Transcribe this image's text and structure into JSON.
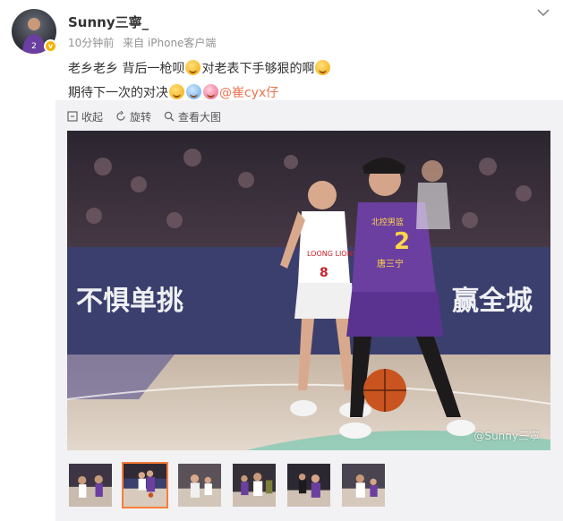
{
  "post": {
    "author": "Sunny三寧_",
    "time": "10分钟前",
    "source": "来自 iPhone客户端",
    "line1_part1": "老乡老乡 背后一枪呗",
    "line1_part2": "对老表下手够狠的啊",
    "line2_part1": "期待下一次的对决",
    "mention": "@崔cyx仔"
  },
  "toolbar": {
    "collect": "收起",
    "rotate": "旋转",
    "view_large": "查看大图"
  },
  "photo": {
    "banner_left": "不惧单挑",
    "banner_right": "赢全城",
    "jersey_white_number": "8",
    "jersey_white_team": "LOONG LIONS",
    "jersey_purple_number": "2",
    "jersey_purple_team": "北控男篮",
    "jersey_purple_name": "唐三宁",
    "watermark": "@Sunny三寧"
  },
  "thumbnails": [
    {
      "id": "thumb-1",
      "active": false
    },
    {
      "id": "thumb-2",
      "active": true
    },
    {
      "id": "thumb-3",
      "active": false
    },
    {
      "id": "thumb-4",
      "active": false
    },
    {
      "id": "thumb-5",
      "active": false
    },
    {
      "id": "thumb-6",
      "active": false
    }
  ],
  "colors": {
    "mention": "#eb7350",
    "thumb_active_border": "#fa7d3c",
    "verify_badge": "#f4b400"
  }
}
